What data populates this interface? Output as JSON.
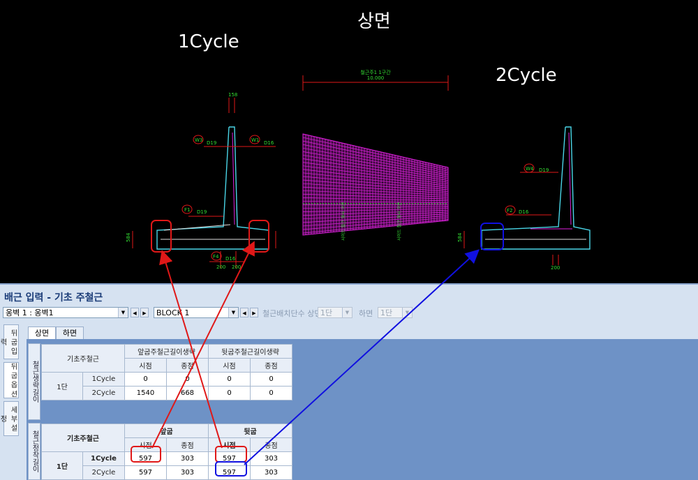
{
  "cad": {
    "title_top": "상면",
    "title_left": "1Cycle",
    "title_right": "2Cycle",
    "plan_label": "철근주1 1구간",
    "plan_dim": "10.000",
    "labels": {
      "w3": "W3",
      "w1": "W1",
      "f1": "F1",
      "f4": "F4",
      "w4": "W4",
      "f2": "F2",
      "d19": "D19",
      "d16": "D16",
      "dim158": "158",
      "dim200": "200",
      "dim584": "584",
      "grid_note1": "사이드 철근 경사 구간",
      "grid_note2": "사이드 철근 경사 구간"
    }
  },
  "panel": {
    "title": "배근 입력 - 기초 주철근",
    "toolbar": {
      "wall_select": "옹벽 1 : 옹벽1",
      "block_select": "BLOCK 1",
      "layers_label": "철근배치단수 상면",
      "layers_value": "1단",
      "bottom_label": "하면",
      "bottom_value": "1단"
    },
    "side_tabs": [
      "뒤 굽 입 력",
      "뒤 굽 옵 션",
      "세 부 설 정"
    ],
    "tabs": [
      "상면",
      "하면"
    ],
    "section1_label": "철근생략길이",
    "section2_label": "철근정착길이",
    "table1": {
      "corner": "기초주철근",
      "group1": "앞굽주철근길이생략",
      "group2": "뒷굽주철근길이생략",
      "sub": [
        "시점",
        "종점",
        "시점",
        "종점"
      ],
      "row_head": "1단",
      "rows": [
        {
          "name": "1Cycle",
          "values": [
            "0",
            "0",
            "0",
            "0"
          ]
        },
        {
          "name": "2Cycle",
          "values": [
            "1540",
            "668",
            "0",
            "0"
          ]
        }
      ]
    },
    "table2": {
      "corner": "기초주철근",
      "group1": "앞굽",
      "group2": "뒷굽",
      "sub": [
        "시점",
        "종점",
        "시점",
        "종점"
      ],
      "row_head": "1단",
      "rows": [
        {
          "name": "1Cycle",
          "values": [
            "597",
            "303",
            "597",
            "303"
          ]
        },
        {
          "name": "2Cycle",
          "values": [
            "597",
            "303",
            "597",
            "303"
          ]
        }
      ]
    }
  },
  "colors": {
    "annotation_red": "#e01818",
    "annotation_blue": "#1010e0",
    "rebar_cyan": "#4ad6e8",
    "grid_magenta": "#e020e0",
    "dim_green": "#33dd33"
  }
}
